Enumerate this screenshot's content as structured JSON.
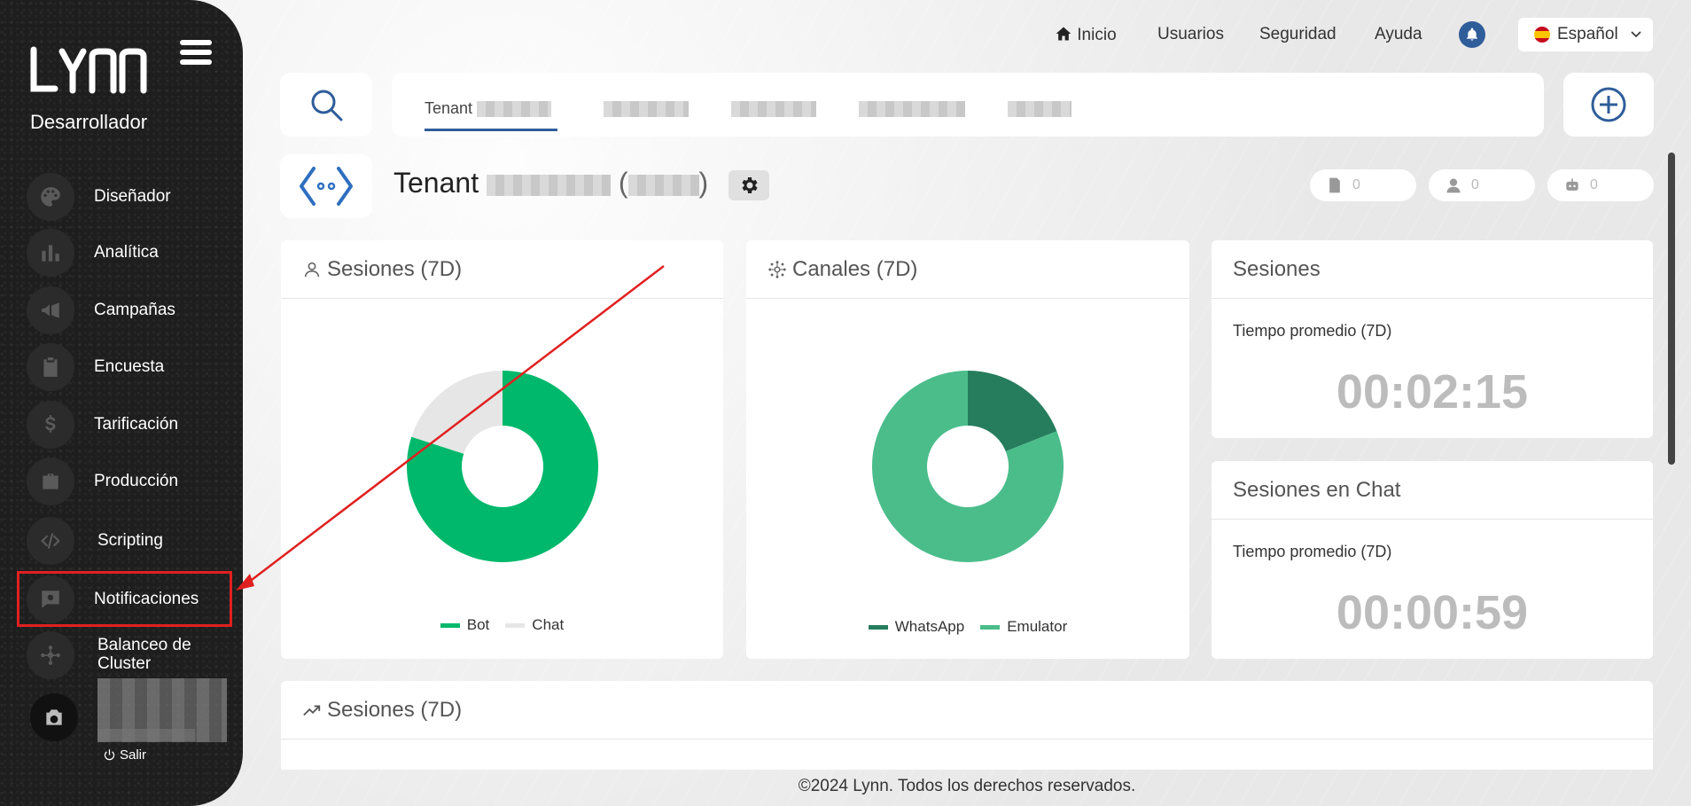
{
  "app": {
    "logo_text": "LYNN",
    "role": "Desarrollador"
  },
  "sidebar": {
    "items": [
      {
        "label": "Diseñador",
        "icon": "palette-icon"
      },
      {
        "label": "Analítica",
        "icon": "bar-chart-icon"
      },
      {
        "label": "Campañas",
        "icon": "megaphone-icon"
      },
      {
        "label": "Encuesta",
        "icon": "clipboard-icon"
      },
      {
        "label": "Tarificación",
        "icon": "dollar-icon"
      },
      {
        "label": "Producción",
        "icon": "briefcase-icon"
      },
      {
        "label": "Scripting",
        "icon": "code-icon"
      },
      {
        "label": "Notificaciones",
        "icon": "message-gear-icon"
      },
      {
        "label": "Balanceo de Cluster",
        "icon": "network-icon"
      }
    ],
    "logout_label": "Salir"
  },
  "topnav": {
    "inicio": "Inicio",
    "usuarios": "Usuarios",
    "seguridad": "Seguridad",
    "ayuda": "Ayuda",
    "language": "Español"
  },
  "tabs": {
    "active_label": "Tenant"
  },
  "tenant": {
    "title": "Tenant",
    "counters": [
      "0",
      "0",
      "0"
    ]
  },
  "panels": {
    "sesiones_7d": "Sesiones (7D)",
    "canales_7d": "Canales (7D)",
    "sesiones": "Sesiones",
    "sesiones_chat": "Sesiones en Chat",
    "tiempo_promedio": "Tiempo promedio (7D)",
    "time_sesiones": "00:02:15",
    "time_chat": "00:00:59",
    "sesiones_7d_bottom": "Sesiones (7D)"
  },
  "chart_data": [
    {
      "type": "pie",
      "title": "Sesiones (7D)",
      "categories": [
        "Bot",
        "Chat"
      ],
      "values": [
        80,
        20
      ],
      "colors": [
        "#00b86b",
        "#e6e6e6"
      ],
      "legend": "bottom"
    },
    {
      "type": "pie",
      "title": "Canales (7D)",
      "categories": [
        "WhatsApp",
        "Emulator"
      ],
      "values": [
        19,
        81
      ],
      "colors": [
        "#267d5e",
        "#4bbd8b"
      ],
      "legend": "bottom"
    }
  ],
  "footer": {
    "text": "©2024 Lynn. Todos los derechos reservados."
  },
  "colors": {
    "accent": "#2f5d9a",
    "highlight": "#e02020",
    "sidebar_bg": "#1e1e1e"
  }
}
